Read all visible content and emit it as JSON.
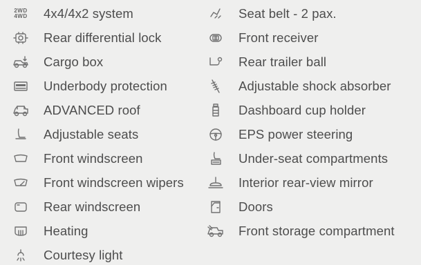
{
  "left_column": [
    {
      "icon": "4x4-icon",
      "label": "4x4/4x2 system",
      "icon_text": [
        "2WD",
        "4WD"
      ]
    },
    {
      "icon": "differential-lock-icon",
      "label": "Rear differential lock"
    },
    {
      "icon": "cargo-box-icon",
      "label": "Cargo box"
    },
    {
      "icon": "underbody-protection-icon",
      "label": "Underbody protection"
    },
    {
      "icon": "roof-icon",
      "label": "ADVANCED roof"
    },
    {
      "icon": "seat-icon",
      "label": "Adjustable seats"
    },
    {
      "icon": "windscreen-icon",
      "label": "Front windscreen"
    },
    {
      "icon": "wiper-icon",
      "label": "Front windscreen wipers"
    },
    {
      "icon": "rear-windscreen-icon",
      "label": "Rear windscreen"
    },
    {
      "icon": "heating-icon",
      "label": "Heating"
    },
    {
      "icon": "courtesy-light-icon",
      "label": "Courtesy light"
    }
  ],
  "right_column": [
    {
      "icon": "seat-belt-icon",
      "label": "Seat belt - 2 pax."
    },
    {
      "icon": "front-receiver-icon",
      "label": "Front receiver"
    },
    {
      "icon": "trailer-ball-icon",
      "label": "Rear trailer ball"
    },
    {
      "icon": "shock-absorber-icon",
      "label": "Adjustable shock absorber"
    },
    {
      "icon": "cup-holder-icon",
      "label": "Dashboard cup holder"
    },
    {
      "icon": "steering-wheel-icon",
      "label": "EPS power steering"
    },
    {
      "icon": "under-seat-compartment-icon",
      "label": "Under-seat compartments"
    },
    {
      "icon": "rear-view-mirror-icon",
      "label": "Interior rear-view mirror"
    },
    {
      "icon": "door-icon",
      "label": "Doors"
    },
    {
      "icon": "storage-compartment-icon",
      "label": "Front storage compartment"
    }
  ]
}
